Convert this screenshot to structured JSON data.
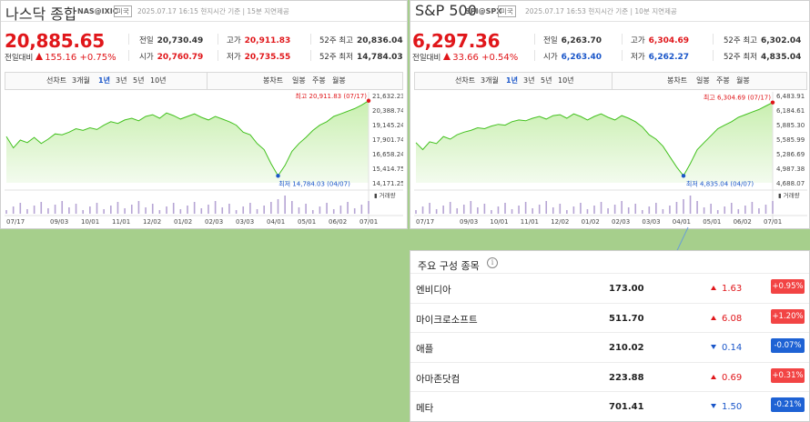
{
  "nasdaq": {
    "name": "나스닥 종합",
    "code": "NAS@IXIC",
    "market": "미국",
    "timestamp": "2025.07.17 16:15 현지시간 기준 | 15분 지연제공",
    "price": "20,885.65",
    "change_label": "전일대비",
    "change": "155.16",
    "change_pct": "+0.75%",
    "stats": {
      "prev_label": "전일",
      "prev": "20,730.49",
      "high_label": "고가",
      "high": "20,911.83",
      "w52h_label": "52주 최고",
      "w52h": "20,836.04",
      "open_label": "시가",
      "open": "20,760.79",
      "low_label": "저가",
      "low": "20,735.55",
      "w52l_label": "52주 최저",
      "w52l": "14,784.03"
    },
    "tabs_left": [
      "선차트",
      "3개월",
      "1년",
      "3년",
      "5년",
      "10년"
    ],
    "tabs_right": [
      "봉차트",
      "일봉",
      "주봉",
      "월봉"
    ],
    "selected_tab": "1년",
    "chart": {
      "yticks": [
        "21,632.23",
        "20,388.74",
        "19,145.24",
        "17,901.74",
        "16,658.24",
        "15,414.75",
        "14,171.25"
      ],
      "xticks": [
        "07/17",
        "09/03",
        "10/01",
        "11/01",
        "12/02",
        "01/02",
        "02/03",
        "03/03",
        "04/01",
        "05/01",
        "06/02",
        "07/01"
      ],
      "high_label": "최고 20,911.83 (07/17)",
      "low_label": "최저 14,784.03 (04/07)",
      "volume_label": "거래량"
    }
  },
  "sp500": {
    "name": "S&P 500",
    "code": "SPI@SPX",
    "market": "미국",
    "timestamp": "2025.07.17 16:53 현지시간 기준 | 10분 지연제공",
    "price": "6,297.36",
    "change_label": "전일대비",
    "change": "33.66",
    "change_pct": "+0.54%",
    "stats": {
      "prev_label": "전일",
      "prev": "6,263.70",
      "high_label": "고가",
      "high": "6,304.69",
      "w52h_label": "52주 최고",
      "w52h": "6,302.04",
      "open_label": "시가",
      "open": "6,263.40",
      "low_label": "저가",
      "low": "6,262.27",
      "w52l_label": "52주 최저",
      "w52l": "4,835.04"
    },
    "tabs_left": [
      "선차트",
      "3개월",
      "1년",
      "3년",
      "5년",
      "10년"
    ],
    "tabs_right": [
      "봉차트",
      "일봉",
      "주봉",
      "월봉"
    ],
    "selected_tab": "1년",
    "chart": {
      "yticks": [
        "6,483.91",
        "6,184.61",
        "5,885.30",
        "5,585.99",
        "5,286.69",
        "4,987.38",
        "4,688.07"
      ],
      "xticks": [
        "07/17",
        "09/03",
        "10/01",
        "11/01",
        "12/02",
        "01/02",
        "02/03",
        "03/03",
        "04/01",
        "05/01",
        "06/02",
        "07/01"
      ],
      "high_label": "최고 6,304.69 (07/17)",
      "low_label": "최저 4,835.04 (04/07)",
      "volume_label": "거래량"
    }
  },
  "constituents": {
    "title": "주요 구성 종목",
    "info_icon": "info-icon",
    "items": [
      {
        "name": "엔비디아",
        "price": "173.00",
        "change": "1.63",
        "pct": "+0.95%",
        "dir": "up"
      },
      {
        "name": "마이크로소프트",
        "price": "511.70",
        "change": "6.08",
        "pct": "+1.20%",
        "dir": "up"
      },
      {
        "name": "애플",
        "price": "210.02",
        "change": "0.14",
        "pct": "-0.07%",
        "dir": "down"
      },
      {
        "name": "아마존닷컴",
        "price": "223.88",
        "change": "0.69",
        "pct": "+0.31%",
        "dir": "up"
      },
      {
        "name": "메타",
        "price": "701.41",
        "change": "1.50",
        "pct": "-0.21%",
        "dir": "down"
      }
    ]
  },
  "colors": {
    "up": "#e0161a",
    "down": "#1a56c9",
    "line": "#43c11f",
    "area": "#d7f2c4",
    "background": "#a6cf8c"
  }
}
